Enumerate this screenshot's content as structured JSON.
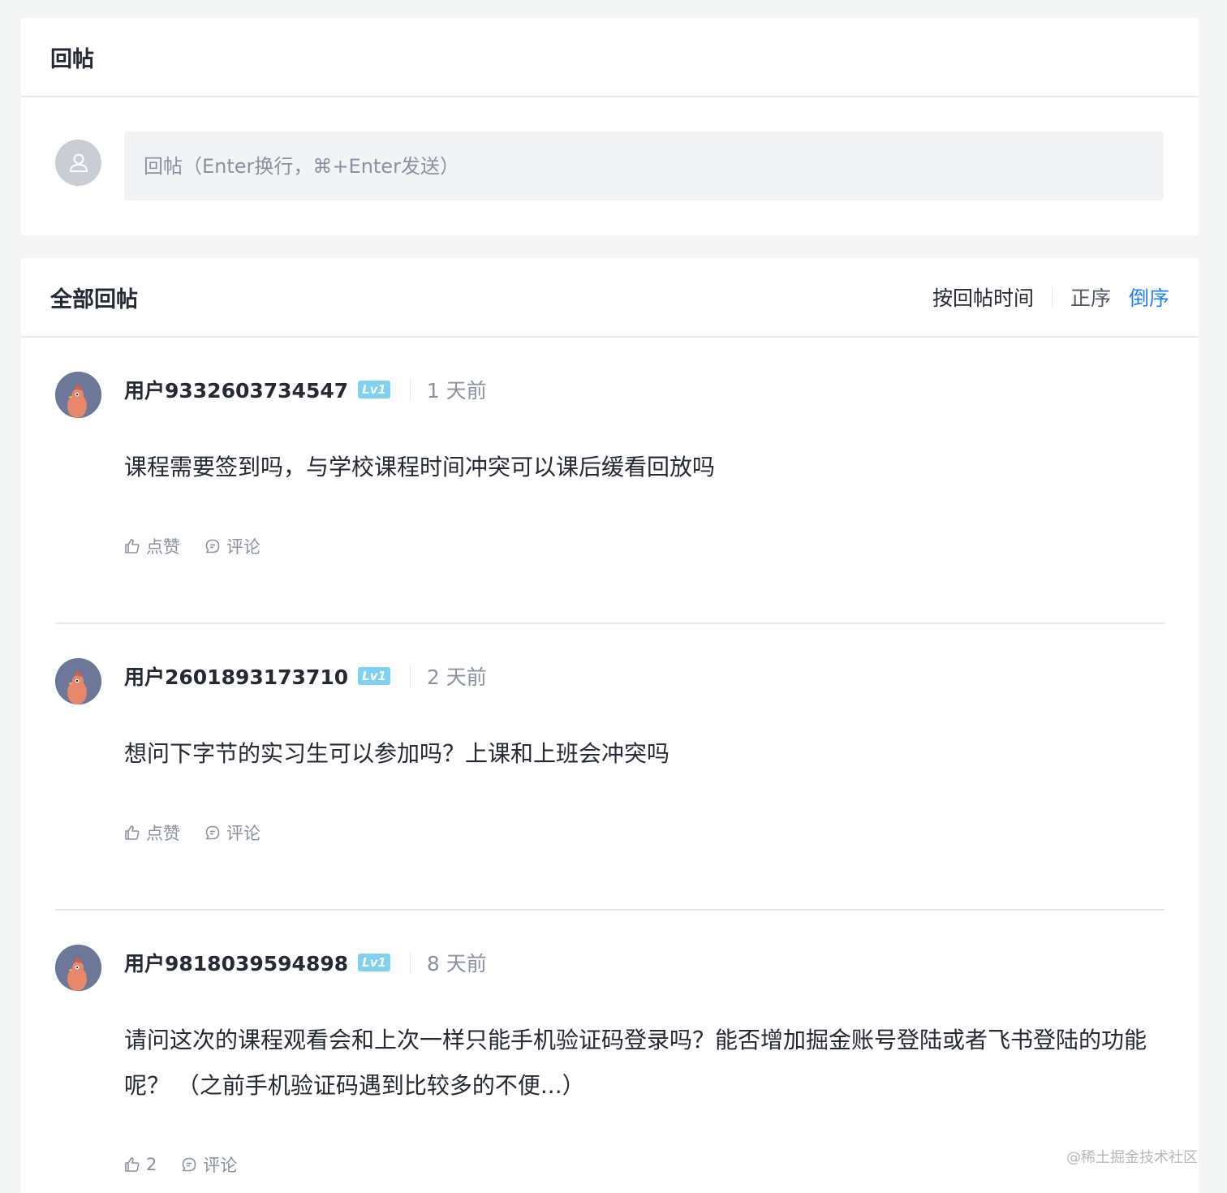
{
  "reply_section": {
    "title": "回帖",
    "input_placeholder": "回帖（Enter换行，⌘+Enter发送）"
  },
  "list_section": {
    "title": "全部回帖",
    "sort_label": "按回帖时间",
    "sort_asc": "正序",
    "sort_desc": "倒序"
  },
  "comments": [
    {
      "user": "用户9332603734547",
      "level": "Lv1",
      "time": "1 天前",
      "text": "课程需要签到吗，与学校课程时间冲突可以课后缓看回放吗",
      "like_label": "点赞",
      "comment_label": "评论"
    },
    {
      "user": "用户2601893173710",
      "level": "Lv1",
      "time": "2 天前",
      "text": "想问下字节的实习生可以参加吗？上课和上班会冲突吗",
      "like_label": "点赞",
      "comment_label": "评论"
    },
    {
      "user": "用户9818039594898",
      "level": "Lv1",
      "time": "8 天前",
      "text": "请问这次的课程观看会和上次一样只能手机验证码登录吗？能否增加掘金账号登陆或者飞书登陆的功能呢？ （之前手机验证码遇到比较多的不便...）",
      "like_label": "2",
      "comment_label": "评论"
    }
  ],
  "watermark": "@稀土掘金技术社区",
  "colors": {
    "page_bg": "#f4f5f5",
    "accent": "#1e80ff",
    "muted": "#8a919f",
    "level_badge": "#7ed1f0"
  }
}
